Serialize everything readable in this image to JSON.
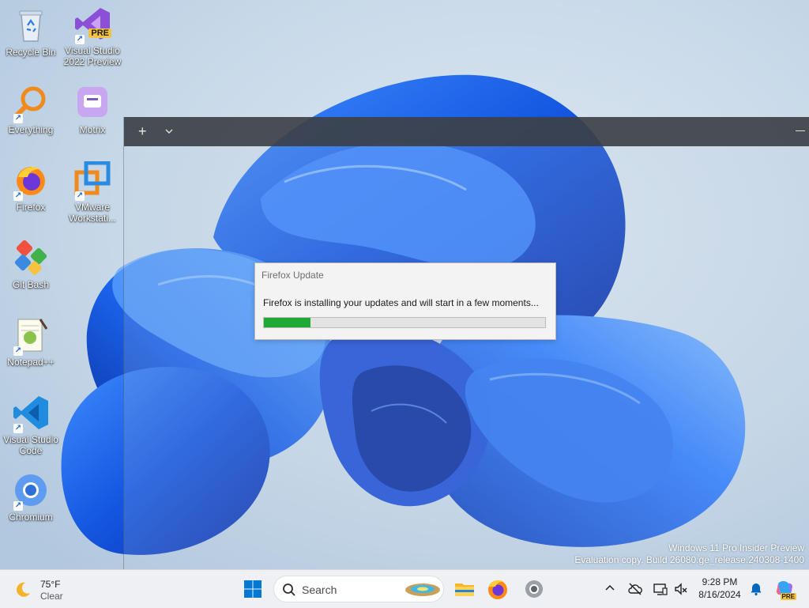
{
  "desktop": {
    "icons": [
      {
        "label": "Recycle Bin"
      },
      {
        "label": "Visual Studio 2022 Preview",
        "badge": "PRE"
      },
      {
        "label": "Everything"
      },
      {
        "label": "Motrix"
      },
      {
        "label": "Firefox"
      },
      {
        "label": "VMware Workstati..."
      },
      {
        "label": "Git Bash"
      },
      {
        "label": "Notepad++"
      },
      {
        "label": "Visual Studio Code"
      },
      {
        "label": "Chromium"
      }
    ]
  },
  "terminal": {
    "new_tab_glyph": "+"
  },
  "dialog": {
    "title": "Firefox Update",
    "message": "Firefox is installing your updates and will start in a few moments...",
    "progress": 0.165,
    "progress_color": "#1faa38"
  },
  "watermark": {
    "line1": "Windows 11 Pro Insider Preview",
    "line2": "Evaluation copy. Build 26080.ge_release.240308-1400"
  },
  "taskbar": {
    "weather": {
      "temp": "75°F",
      "condition": "Clear"
    },
    "search": {
      "label": "Search"
    },
    "clock": {
      "time": "9:28 PM",
      "date": "8/16/2024"
    },
    "copilot_badge": "PRE"
  },
  "colors": {
    "accent": "#0067c0",
    "wallpaper_blue": "#1d5de6",
    "taskbar_bg": "#eef0f4"
  }
}
